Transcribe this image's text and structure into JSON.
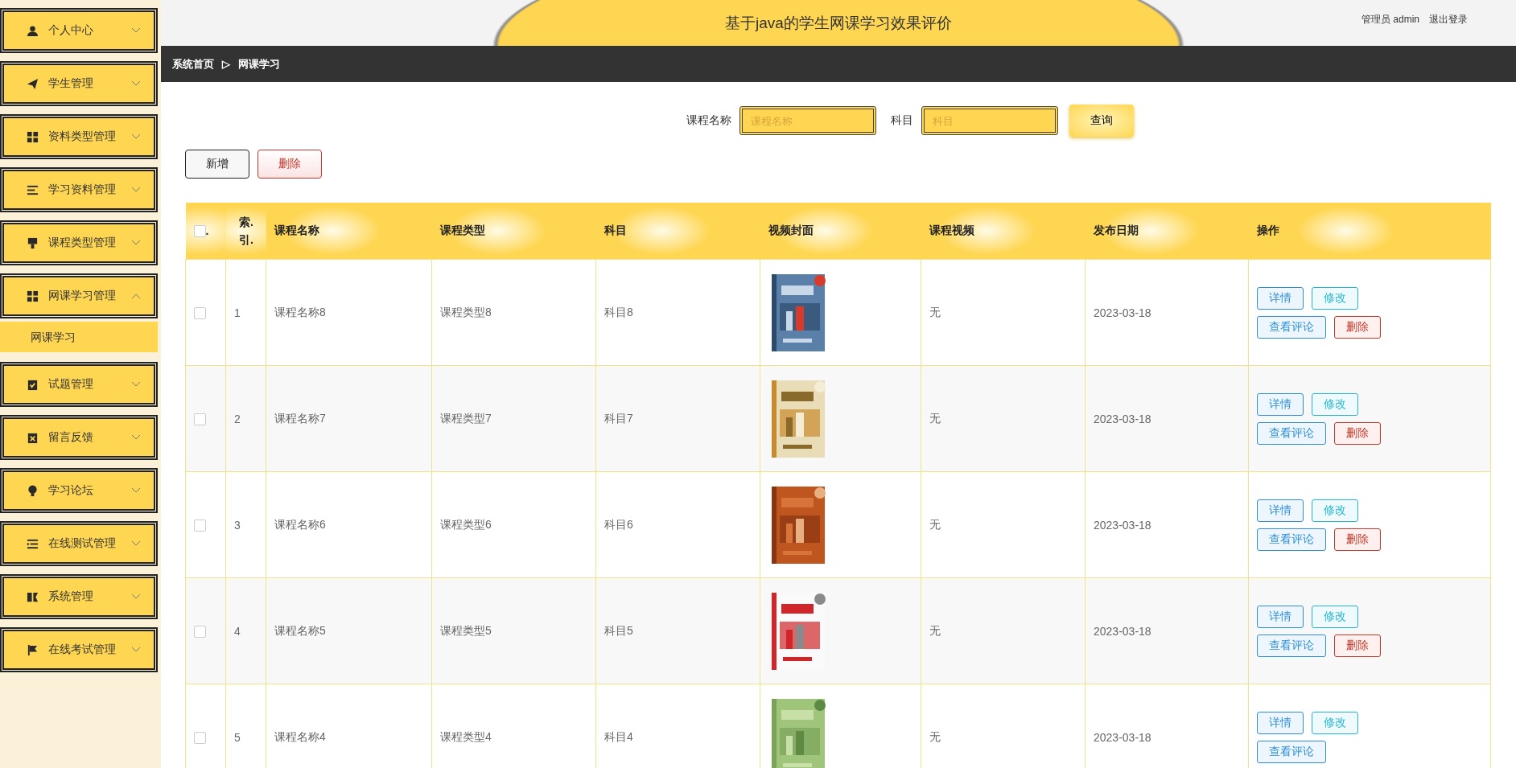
{
  "header": {
    "title": "基于java的学生网课学习效果评价",
    "user": "管理员 admin",
    "logout": "退出登录"
  },
  "breadcrumb": [
    "系统首页",
    "▷",
    "网课学习"
  ],
  "sidebar": {
    "items": [
      {
        "label": "个人中心",
        "expanded": false
      },
      {
        "label": "学生管理",
        "expanded": false
      },
      {
        "label": "资料类型管理",
        "expanded": false
      },
      {
        "label": "学习资料管理",
        "expanded": false
      },
      {
        "label": "课程类型管理",
        "expanded": false
      },
      {
        "label": "网课学习管理",
        "expanded": true,
        "children": [
          {
            "label": "网课学习"
          }
        ]
      },
      {
        "label": "试题管理",
        "expanded": false
      },
      {
        "label": "留言反馈",
        "expanded": false
      },
      {
        "label": "学习论坛",
        "expanded": false
      },
      {
        "label": "在线测试管理",
        "expanded": false
      },
      {
        "label": "系统管理",
        "expanded": false
      },
      {
        "label": "在线考试管理",
        "expanded": false
      }
    ]
  },
  "search": {
    "fields": [
      {
        "label": "课程名称",
        "placeholder": "课程名称"
      },
      {
        "label": "科目",
        "placeholder": "科目"
      }
    ],
    "button": "查询"
  },
  "toolbar": [
    {
      "label": "新增",
      "kind": "add"
    },
    {
      "label": "删除",
      "kind": "delete"
    }
  ],
  "table": {
    "select_all": {
      "checked": false,
      "label": "."
    },
    "columns": [
      "索.引.",
      "课程名称",
      "课程类型",
      "科目",
      "视频封面",
      "课程视频",
      "发布日期",
      "操作"
    ],
    "rows": [
      {
        "checked": false,
        "index": "1",
        "name": "课程名称8",
        "type": "课程类型8",
        "subject": "科目8",
        "cover": {
          "kind": "picture"
        },
        "video": "无",
        "date": "2023-03-18",
        "actions": [
          {
            "label": "详情",
            "kind": "detail"
          },
          {
            "label": "修改",
            "kind": "edit"
          },
          {
            "label": "查看评论",
            "kind": "detail"
          },
          {
            "label": "删除",
            "kind": "delete"
          }
        ]
      },
      {
        "checked": false,
        "index": "2",
        "name": "课程名称7",
        "type": "课程类型7",
        "subject": "科目7",
        "cover": {
          "kind": "picture"
        },
        "video": "无",
        "date": "2023-03-18",
        "actions": [
          {
            "label": "详情",
            "kind": "detail"
          },
          {
            "label": "修改",
            "kind": "edit"
          },
          {
            "label": "查看评论",
            "kind": "detail"
          },
          {
            "label": "删除",
            "kind": "delete"
          }
        ]
      },
      {
        "checked": false,
        "index": "3",
        "name": "课程名称6",
        "type": "课程类型6",
        "subject": "科目6",
        "cover": {
          "kind": "picture"
        },
        "video": "无",
        "date": "2023-03-18",
        "actions": [
          {
            "label": "详情",
            "kind": "detail"
          },
          {
            "label": "修改",
            "kind": "edit"
          },
          {
            "label": "查看评论",
            "kind": "detail"
          },
          {
            "label": "删除",
            "kind": "delete"
          }
        ]
      },
      {
        "checked": false,
        "index": "4",
        "name": "课程名称5",
        "type": "课程类型5",
        "subject": "科目5",
        "cover": {
          "kind": "picture"
        },
        "video": "无",
        "date": "2023-03-18",
        "actions": [
          {
            "label": "详情",
            "kind": "detail"
          },
          {
            "label": "修改",
            "kind": "edit"
          },
          {
            "label": "查看评论",
            "kind": "detail"
          },
          {
            "label": "删除",
            "kind": "delete"
          }
        ]
      },
      {
        "checked": false,
        "index": "5",
        "name": "课程名称4",
        "type": "课程类型4",
        "subject": "科目4",
        "cover": {
          "kind": "picture"
        },
        "video": "无",
        "date": "2023-03-18",
        "actions": [
          {
            "label": "详情",
            "kind": "detail"
          },
          {
            "label": "修改",
            "kind": "edit"
          },
          {
            "label": "查看评论",
            "kind": "detail"
          }
        ]
      }
    ]
  }
}
